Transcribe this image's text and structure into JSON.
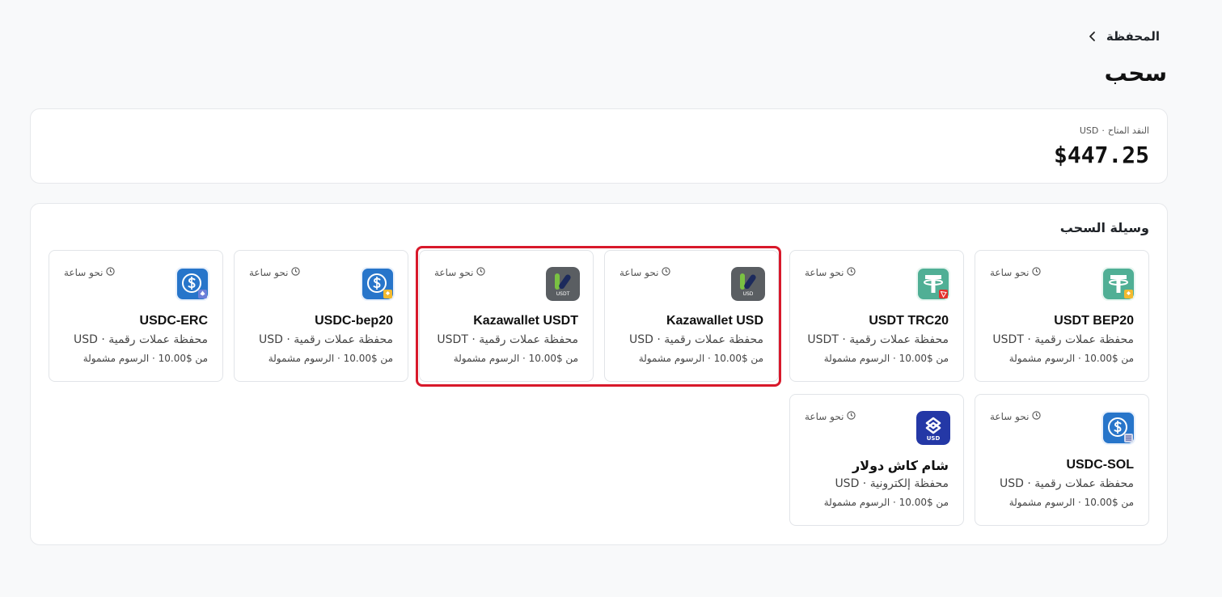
{
  "breadcrumb": {
    "label": "المحفظة"
  },
  "page": {
    "title": "سحب"
  },
  "balance": {
    "label": "النقد المتاح",
    "separator": "·",
    "currency": "USD",
    "amount": "$447.25"
  },
  "methods": {
    "title": "وسيلة السحب",
    "items": [
      {
        "name": "USDT BEP20",
        "type": "محفظة عملات رقمية · USDT",
        "fees": "من $10.00 · الرسوم مشمولة",
        "time": "نحو ساعة",
        "icon": "tether-bep20-icon"
      },
      {
        "name": "USDT TRC20",
        "type": "محفظة عملات رقمية · USDT",
        "fees": "من $10.00 · الرسوم مشمولة",
        "time": "نحو ساعة",
        "icon": "tether-trc20-icon"
      },
      {
        "name": "Kazawallet USD",
        "type": "محفظة عملات رقمية · USD",
        "fees": "من $10.00 · الرسوم مشمولة",
        "time": "نحو ساعة",
        "icon": "kazawallet-usd-icon"
      },
      {
        "name": "Kazawallet USDT",
        "type": "محفظة عملات رقمية · USDT",
        "fees": "من $10.00 · الرسوم مشمولة",
        "time": "نحو ساعة",
        "icon": "kazawallet-usdt-icon"
      },
      {
        "name": "USDC-bep20",
        "type": "محفظة عملات رقمية · USD",
        "fees": "من $10.00 · الرسوم مشمولة",
        "time": "نحو ساعة",
        "icon": "usdc-bep20-icon"
      },
      {
        "name": "USDC-ERC",
        "type": "محفظة عملات رقمية · USD",
        "fees": "من $10.00 · الرسوم مشمولة",
        "time": "نحو ساعة",
        "icon": "usdc-erc-icon"
      },
      {
        "name": "USDC-SOL",
        "type": "محفظة عملات رقمية · USD",
        "fees": "من $10.00 · الرسوم مشمولة",
        "time": "نحو ساعة",
        "icon": "usdc-sol-icon"
      },
      {
        "name": "شام كاش دولار",
        "type": "محفظة إلكترونية · USD",
        "fees": "من $10.00 · الرسوم مشمولة",
        "time": "نحو ساعة",
        "icon": "shamcash-usd-icon"
      }
    ]
  },
  "icon_texts": {
    "kaza_usd": "USD",
    "kaza_usdt": "USDT",
    "shamcash": "USD"
  },
  "colors": {
    "highlight": "#d8192b",
    "tether": "#50af95",
    "usdc": "#2775ca",
    "kazawallet": "#5a5e62",
    "shamcash": "#2438a6",
    "kaza_green": "#7ac142"
  }
}
